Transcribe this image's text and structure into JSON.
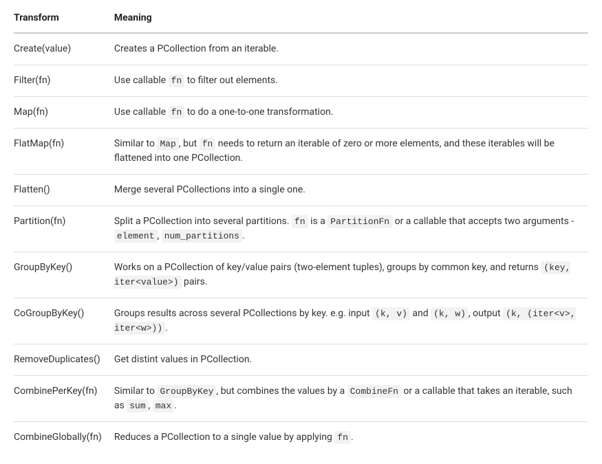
{
  "table": {
    "headers": {
      "transform": "Transform",
      "meaning": "Meaning"
    },
    "rows": [
      {
        "transform": "Create(value)",
        "meaning": [
          {
            "t": "text",
            "v": "Creates a PCollection from an iterable."
          }
        ]
      },
      {
        "transform": "Filter(fn)",
        "meaning": [
          {
            "t": "text",
            "v": "Use callable "
          },
          {
            "t": "code",
            "v": "fn"
          },
          {
            "t": "text",
            "v": " to filter out elements."
          }
        ]
      },
      {
        "transform": "Map(fn)",
        "meaning": [
          {
            "t": "text",
            "v": "Use callable "
          },
          {
            "t": "code",
            "v": "fn"
          },
          {
            "t": "text",
            "v": " to do a one-to-one transformation."
          }
        ]
      },
      {
        "transform": "FlatMap(fn)",
        "meaning": [
          {
            "t": "text",
            "v": "Similar to "
          },
          {
            "t": "code",
            "v": "Map"
          },
          {
            "t": "text",
            "v": ", but "
          },
          {
            "t": "code",
            "v": "fn"
          },
          {
            "t": "text",
            "v": " needs to return an iterable of zero or more elements, and these iterables will be flattened into one PCollection."
          }
        ]
      },
      {
        "transform": "Flatten()",
        "meaning": [
          {
            "t": "text",
            "v": "Merge several PCollections into a single one."
          }
        ]
      },
      {
        "transform": "Partition(fn)",
        "meaning": [
          {
            "t": "text",
            "v": "Split a PCollection into several partitions. "
          },
          {
            "t": "code",
            "v": "fn"
          },
          {
            "t": "text",
            "v": " is a "
          },
          {
            "t": "code",
            "v": "PartitionFn"
          },
          {
            "t": "text",
            "v": " or a callable that accepts two arguments - "
          },
          {
            "t": "code",
            "v": "element"
          },
          {
            "t": "text",
            "v": ", "
          },
          {
            "t": "code",
            "v": "num_partitions"
          },
          {
            "t": "text",
            "v": "."
          }
        ]
      },
      {
        "transform": "GroupByKey()",
        "meaning": [
          {
            "t": "text",
            "v": "Works on a PCollection of key/value pairs (two-element tuples), groups by common key, and returns "
          },
          {
            "t": "code",
            "v": "(key, iter<value>)"
          },
          {
            "t": "text",
            "v": " pairs."
          }
        ]
      },
      {
        "transform": "CoGroupByKey()",
        "meaning": [
          {
            "t": "text",
            "v": "Groups results across several PCollections by key. e.g. input "
          },
          {
            "t": "code",
            "v": "(k, v)"
          },
          {
            "t": "text",
            "v": " and "
          },
          {
            "t": "code",
            "v": "(k, w)"
          },
          {
            "t": "text",
            "v": ", output "
          },
          {
            "t": "code",
            "v": "(k, (iter<v>, iter<w>))"
          },
          {
            "t": "text",
            "v": "."
          }
        ]
      },
      {
        "transform": "RemoveDuplicates()",
        "meaning": [
          {
            "t": "text",
            "v": "Get distint values in PCollection."
          }
        ]
      },
      {
        "transform": "CombinePerKey(fn)",
        "meaning": [
          {
            "t": "text",
            "v": "Similar to "
          },
          {
            "t": "code",
            "v": "GroupByKey"
          },
          {
            "t": "text",
            "v": ", but combines the values by a "
          },
          {
            "t": "code",
            "v": "CombineFn"
          },
          {
            "t": "text",
            "v": " or a callable that takes an iterable, such as "
          },
          {
            "t": "code",
            "v": "sum"
          },
          {
            "t": "text",
            "v": ", "
          },
          {
            "t": "code",
            "v": "max"
          },
          {
            "t": "text",
            "v": "."
          }
        ]
      },
      {
        "transform": "CombineGlobally(fn)",
        "meaning": [
          {
            "t": "text",
            "v": "Reduces a PCollection to a single value by applying "
          },
          {
            "t": "code",
            "v": "fn"
          },
          {
            "t": "text",
            "v": "."
          }
        ]
      }
    ]
  }
}
